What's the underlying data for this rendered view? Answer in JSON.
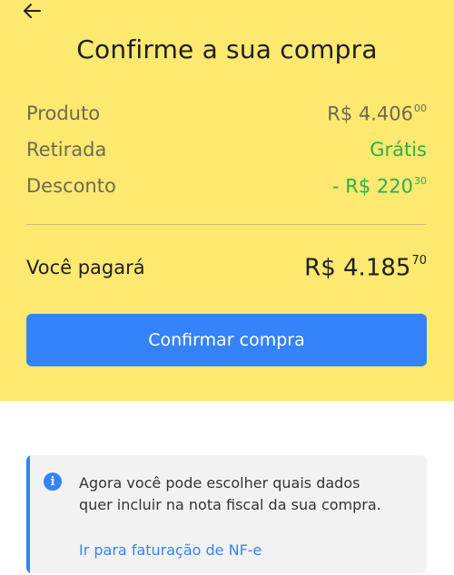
{
  "header": {
    "title": "Confirme a sua compra",
    "back_icon": "arrow-left-icon"
  },
  "summary": {
    "product": {
      "label": "Produto",
      "value": "R$ 4.406",
      "cents": "00"
    },
    "pickup": {
      "label": "Retirada",
      "value": "Grátis"
    },
    "discount": {
      "label": "Desconto",
      "value": "- R$ 220",
      "cents": "30"
    }
  },
  "total": {
    "label": "Você pagará",
    "value": "R$ 4.185",
    "cents": "70"
  },
  "confirm_button": {
    "label": "Confirmar compra"
  },
  "info": {
    "icon": "info-icon",
    "message": "Agora você pode escolher quais dados quer incluir na nota fiscal da sua compra.",
    "link": "Ir para faturação de NF-e"
  },
  "colors": {
    "header_bg": "#fde870",
    "accent_blue": "#3483fa",
    "discount_green": "#2fae4a"
  }
}
